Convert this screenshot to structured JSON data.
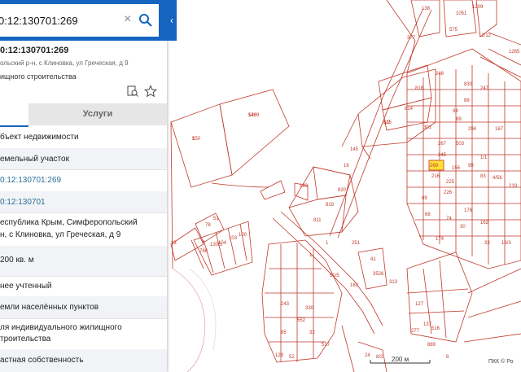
{
  "search": {
    "value": "0:12:130701:269",
    "clear_icon": "close-icon",
    "search_icon": "search-icon"
  },
  "collapse_icon": "chevron-left-icon",
  "object": {
    "title": "0:12:130701:269",
    "address": "ольский р-н, с Клиновка, ул Греческая, д 9",
    "use": "ищного строительства",
    "actions": [
      "compare-icon",
      "star-icon"
    ]
  },
  "tabs": {
    "info_label": "",
    "services_label": "Услуги"
  },
  "rows": [
    {
      "label": "бъект недвижимости"
    },
    {
      "label": "емельный участок"
    },
    {
      "label": "0:12:130701:269",
      "link": true
    },
    {
      "label": "0:12:130701",
      "link": true
    },
    {
      "label": "еспублика Крым, Симферопольский",
      "label2": "н, с Клиновка, ул Греческая, д 9"
    },
    {
      "label": "200 кв. м"
    },
    {
      "label": "нее учтенный"
    },
    {
      "label": "емли населённых пунктов"
    },
    {
      "label": "ля индивидуального жилищного",
      "label2": "троительства"
    },
    {
      "label": "астная собственность"
    }
  ],
  "map": {
    "parcel_labels": [
      "550",
      "548",
      "815",
      "814",
      "818",
      "820",
      "819",
      "811",
      "183",
      "145",
      "16",
      "301",
      "267",
      "245",
      "269",
      "216",
      "226",
      "156",
      "225",
      "69",
      "68",
      "138",
      "377",
      "575",
      "1209",
      "12/12",
      "1265",
      "246",
      "830",
      "247",
      "89",
      "94",
      "89",
      "294",
      "503",
      "1/1",
      "99",
      "83",
      "4/56",
      "167",
      "219",
      "176",
      "162",
      "30",
      "33",
      "174",
      "74",
      "78",
      "51",
      "23",
      "786",
      "130/1",
      "104",
      "103",
      "100",
      "1",
      "41",
      "3526",
      "313",
      "163",
      "51/5",
      "243",
      "95",
      "552",
      "330",
      "277",
      "137",
      "516",
      "127",
      "128",
      "52",
      "889",
      "32",
      "517",
      "24",
      "8/3",
      "8",
      "251",
      "1",
      "1051",
      "16/3",
      "1",
      "1209",
      "1/2"
    ],
    "highlight_label": "269",
    "highlight_color": "#ffe033",
    "line_color": "#c0392b"
  },
  "scale": "200 м",
  "copyright": "ПКК © Ро"
}
